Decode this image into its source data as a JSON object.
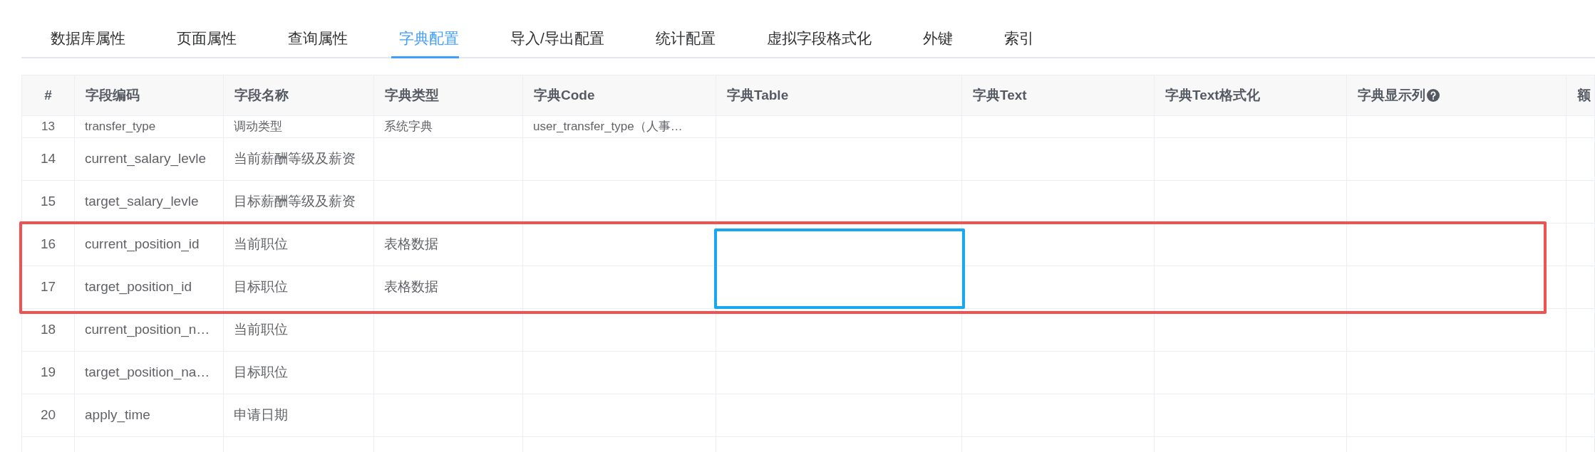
{
  "tabs": [
    {
      "label": "数据库属性",
      "selected": false
    },
    {
      "label": "页面属性",
      "selected": false
    },
    {
      "label": "查询属性",
      "selected": false
    },
    {
      "label": "字典配置",
      "selected": true
    },
    {
      "label": "导入/导出配置",
      "selected": false
    },
    {
      "label": "统计配置",
      "selected": false
    },
    {
      "label": "虚拟字段格式化",
      "selected": false
    },
    {
      "label": "外键",
      "selected": false
    },
    {
      "label": "索引",
      "selected": false
    }
  ],
  "table": {
    "columns": [
      {
        "label": "#",
        "help": false,
        "framed": false
      },
      {
        "label": "字段编码",
        "help": false,
        "framed": false
      },
      {
        "label": "字段名称",
        "help": false,
        "framed": false
      },
      {
        "label": "字典类型",
        "help": false,
        "framed": false
      },
      {
        "label": "字典Code",
        "help": false,
        "framed": false
      },
      {
        "label": "字典Table",
        "help": false,
        "framed": true
      },
      {
        "label": "字典Text",
        "help": false,
        "framed": false
      },
      {
        "label": "字典Text格式化",
        "help": false,
        "framed": false
      },
      {
        "label": "字典显示列",
        "help": true,
        "framed": false
      },
      {
        "label": "额",
        "help": false,
        "framed": false
      }
    ],
    "rows": [
      {
        "kind": "cut",
        "framed": false,
        "cells": [
          "13",
          "transfer_type",
          "调动类型",
          "系统字典",
          "user_transfer_type（人事…"
        ]
      },
      {
        "kind": "whole",
        "framed": false,
        "cells": [
          "14",
          "current_salary_levle",
          "当前薪酬等级及薪资"
        ]
      },
      {
        "kind": "whole",
        "framed": false,
        "cells": [
          "15",
          "target_salary_levle",
          "目标薪酬等级及薪资"
        ]
      },
      {
        "kind": "whole",
        "framed": true,
        "cells": [
          "16",
          "current_position_id",
          "当前职位",
          "表格数据"
        ]
      },
      {
        "kind": "whole",
        "framed": true,
        "cells": [
          "17",
          "target_position_id",
          "目标职位",
          "表格数据"
        ]
      },
      {
        "kind": "whole",
        "framed": false,
        "cells": [
          "18",
          "current_position_n…",
          "当前职位"
        ]
      },
      {
        "kind": "whole",
        "framed": false,
        "cells": [
          "19",
          "target_position_na…",
          "目标职位"
        ]
      },
      {
        "kind": "whole",
        "framed": false,
        "cells": [
          "20",
          "apply_time",
          "申请日期"
        ]
      }
    ]
  }
}
